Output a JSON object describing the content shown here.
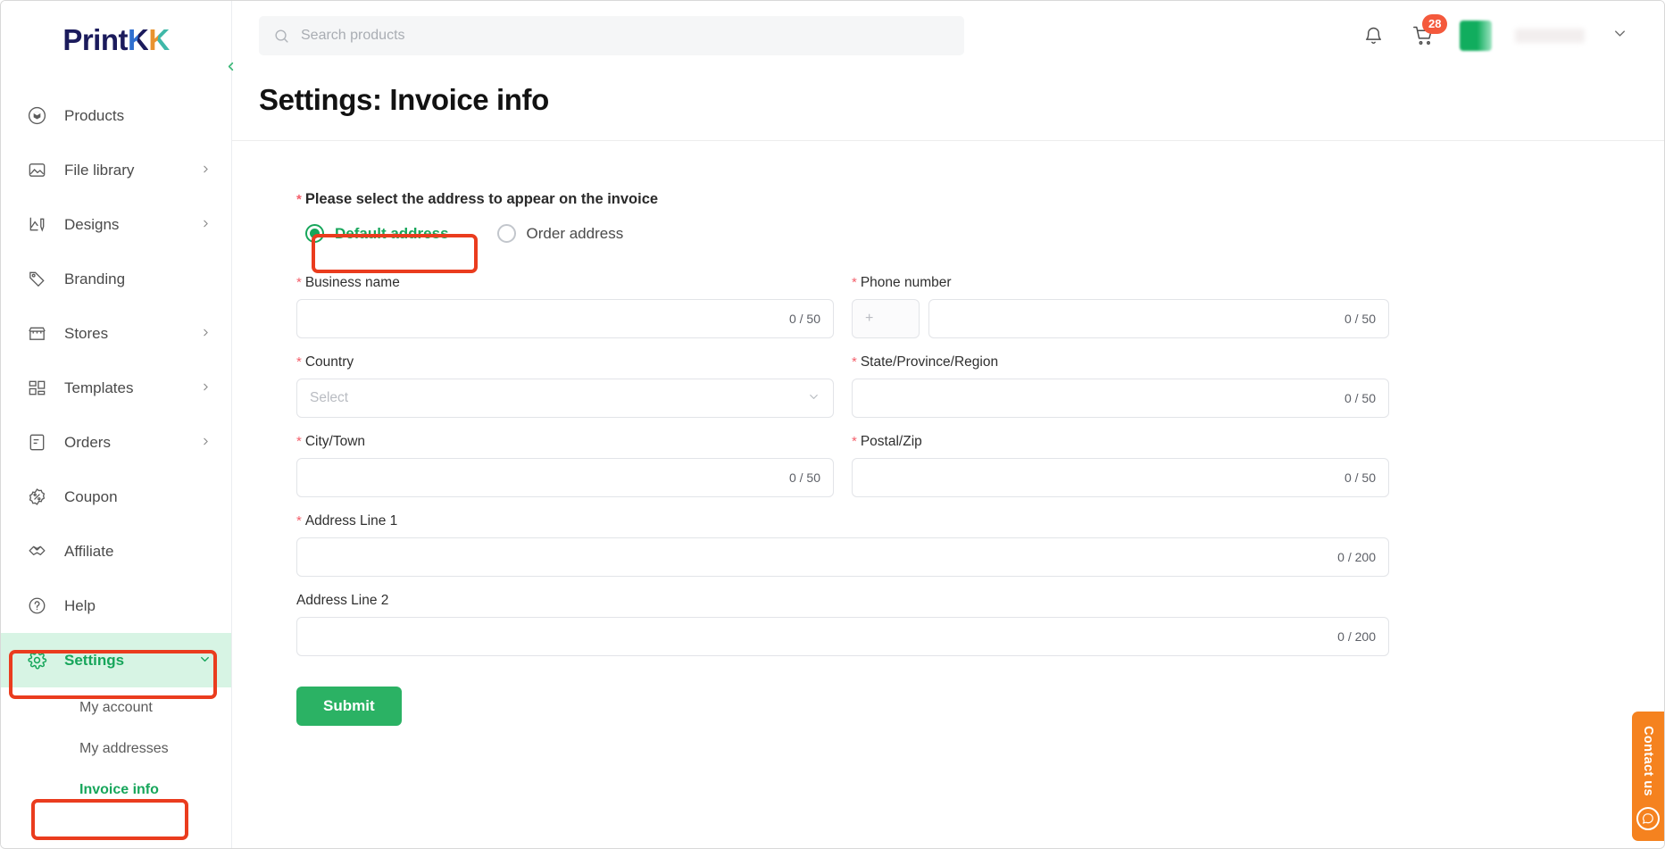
{
  "brand": {
    "logo_print": "Print",
    "logo_k1": "K",
    "logo_k2": "K",
    "collapse_icon": "chevron-left-icon"
  },
  "sidebar": {
    "items": [
      {
        "label": "Products",
        "icon": "box-icon",
        "has_arrow": false,
        "active": false
      },
      {
        "label": "File library",
        "icon": "image-icon",
        "has_arrow": true,
        "active": false
      },
      {
        "label": "Designs",
        "icon": "design-icon",
        "has_arrow": true,
        "active": false
      },
      {
        "label": "Branding",
        "icon": "tag-icon",
        "has_arrow": false,
        "active": false
      },
      {
        "label": "Stores",
        "icon": "store-icon",
        "has_arrow": true,
        "active": false
      },
      {
        "label": "Templates",
        "icon": "template-icon",
        "has_arrow": true,
        "active": false
      },
      {
        "label": "Orders",
        "icon": "order-icon",
        "has_arrow": true,
        "active": false
      },
      {
        "label": "Coupon",
        "icon": "percent-icon",
        "has_arrow": false,
        "active": false
      },
      {
        "label": "Affiliate",
        "icon": "handshake-icon",
        "has_arrow": false,
        "active": false
      },
      {
        "label": "Help",
        "icon": "question-icon",
        "has_arrow": false,
        "active": false
      },
      {
        "label": "Settings",
        "icon": "gear-icon",
        "has_arrow": true,
        "active": true
      }
    ],
    "subitems": [
      {
        "label": "My account",
        "active": false
      },
      {
        "label": "My addresses",
        "active": false
      },
      {
        "label": "Invoice info",
        "active": true
      }
    ],
    "active_color": "#17a65b",
    "active_bg": "#d7f4e4"
  },
  "topbar": {
    "search_placeholder": "Search products",
    "search_value": "",
    "notification_icon": "bell-icon",
    "cart_icon": "cart-icon",
    "cart_count": "28",
    "cart_badge_color": "#f4593c",
    "account_chevron": "chevron-down-icon"
  },
  "page": {
    "title": "Settings: Invoice info"
  },
  "form": {
    "address_choice_label": "Please select the address to appear on the invoice",
    "address_choice_required": true,
    "options": [
      {
        "label": "Default address",
        "selected": true
      },
      {
        "label": "Order address",
        "selected": false
      }
    ],
    "fields": [
      {
        "key": "business_name",
        "label": "Business name",
        "required": true,
        "type": "text",
        "value": "",
        "counter": "0 / 50",
        "column": "left"
      },
      {
        "key": "phone_number",
        "label": "Phone number",
        "required": true,
        "type": "phone",
        "value": "",
        "counter": "0 / 50",
        "column": "right",
        "code_prefix": "+"
      },
      {
        "key": "country",
        "label": "Country",
        "required": true,
        "type": "select",
        "value": "",
        "placeholder": "Select",
        "column": "left"
      },
      {
        "key": "state",
        "label": "State/Province/Region",
        "required": true,
        "type": "text",
        "value": "",
        "counter": "0 / 50",
        "column": "right"
      },
      {
        "key": "city",
        "label": "City/Town",
        "required": true,
        "type": "text",
        "value": "",
        "counter": "0 / 50",
        "column": "left"
      },
      {
        "key": "postal",
        "label": "Postal/Zip",
        "required": true,
        "type": "text",
        "value": "",
        "counter": "0 / 50",
        "column": "right"
      },
      {
        "key": "address1",
        "label": "Address Line 1",
        "required": true,
        "type": "text",
        "value": "",
        "counter": "0 / 200",
        "column": "full"
      },
      {
        "key": "address2",
        "label": "Address Line 2",
        "required": false,
        "type": "text",
        "value": "",
        "counter": "0 / 200",
        "column": "full"
      }
    ],
    "submit_label": "Submit",
    "submit_color": "#2bb264"
  },
  "contact_widget": {
    "label": "Contact us",
    "icon": "chat-bubble-icon",
    "color": "#f5821f"
  },
  "annotations": {
    "color": "#ea3c1e",
    "boxes": [
      "settings-nav-item",
      "invoice-info-subitem",
      "default-address-radio"
    ]
  }
}
